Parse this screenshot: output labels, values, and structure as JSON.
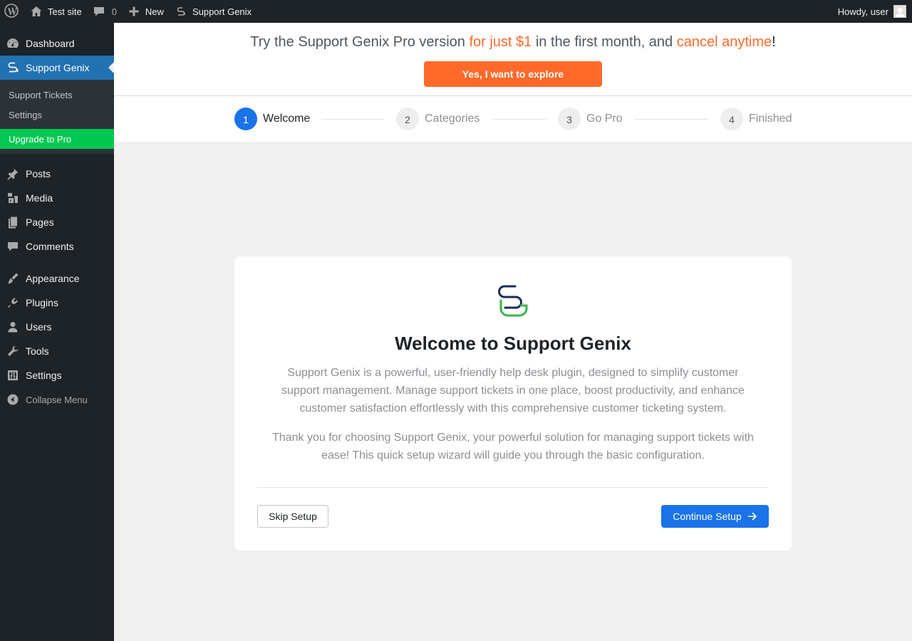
{
  "adminbar": {
    "site_name": "Test site",
    "comments_count": "0",
    "new_label": "New",
    "plugin_label": "Support Genix",
    "howdy": "Howdy, user"
  },
  "sidebar": {
    "items": [
      {
        "label": "Dashboard",
        "icon": "dashboard-icon"
      },
      {
        "label": "Support Genix",
        "icon": "support-genix-icon"
      },
      {
        "label": "Posts",
        "icon": "pin-icon"
      },
      {
        "label": "Media",
        "icon": "media-icon"
      },
      {
        "label": "Pages",
        "icon": "pages-icon"
      },
      {
        "label": "Comments",
        "icon": "comment-icon"
      },
      {
        "label": "Appearance",
        "icon": "brush-icon"
      },
      {
        "label": "Plugins",
        "icon": "plugin-icon"
      },
      {
        "label": "Users",
        "icon": "user-icon"
      },
      {
        "label": "Tools",
        "icon": "wrench-icon"
      },
      {
        "label": "Settings",
        "icon": "sliders-icon"
      }
    ],
    "submenu": [
      "Support Tickets",
      "Settings",
      "Upgrade to Pro"
    ],
    "collapse_label": "Collapse Menu"
  },
  "promo": {
    "text_a": "Try the Support Genix Pro version ",
    "text_b": "for just $1",
    "text_c": " in the first month, and ",
    "text_d": "cancel anytime",
    "text_e": "!",
    "button": "Yes, I want to explore"
  },
  "steps": [
    {
      "num": "1",
      "label": "Welcome"
    },
    {
      "num": "2",
      "label": "Categories"
    },
    {
      "num": "3",
      "label": "Go Pro"
    },
    {
      "num": "4",
      "label": "Finished"
    }
  ],
  "card": {
    "title": "Welcome to Support Genix",
    "para1": "Support Genix is a powerful, user-friendly help desk plugin, designed to simplify customer support management. Manage support tickets in one place, boost productivity, and enhance customer satisfaction effortlessly with this comprehensive customer ticketing system.",
    "para2": "Thank you for choosing Support Genix, your powerful solution for managing support tickets with ease! This quick setup wizard will guide you through the basic configuration.",
    "skip_label": "Skip Setup",
    "continue_label": "Continue Setup"
  },
  "colors": {
    "accent_blue": "#1a73e8",
    "promo_orange": "#ff6a2b",
    "upgrade_green": "#00c853",
    "wp_blue": "#2271b1"
  }
}
